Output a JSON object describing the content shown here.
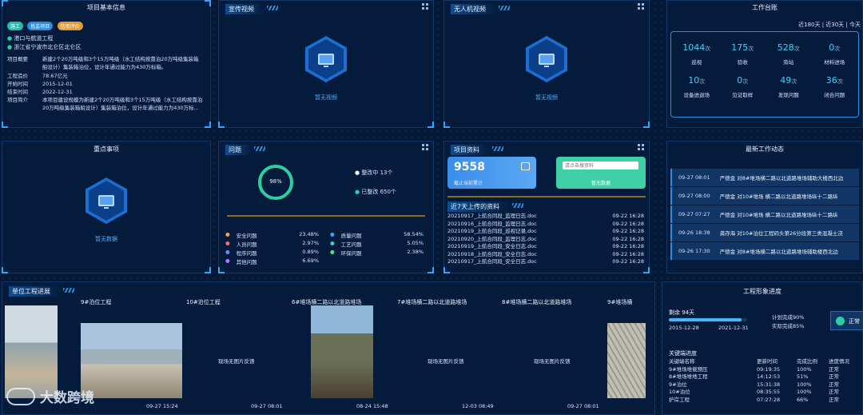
{
  "project_info": {
    "title": "项目基本信息",
    "tags": [
      "施工",
      "抵监项目",
      "信用评价"
    ],
    "bullets": [
      "港口与航道工程",
      "浙江省宁波市北仑区北仑区"
    ],
    "fields": [
      {
        "label": "项目概要",
        "value": "新建2个20万吨级和3个15万吨级（水工结构按靠泊20万吨级集装箱船设计）集装箱泊位，设计年通过能力为430万标箱。"
      },
      {
        "label": "工程造价",
        "value": "78.67亿元"
      },
      {
        "label": "开始时间",
        "value": "2015-12-01"
      },
      {
        "label": "结束时间",
        "value": "2022-12-31"
      },
      {
        "label": "项目简介",
        "value": "本项目建设规模为新建2个20万吨级和3个15万吨级（水工结构按靠泊20万吨级集装箱船设计）集装箱泊位，设计年通过能力为430万标..."
      }
    ]
  },
  "promo_video": {
    "title": "宣传视频",
    "empty": "暂无视频",
    "icon": "monitor-icon"
  },
  "drone_video": {
    "title": "无人机视频",
    "empty": "暂无视频",
    "icon": "monitor-icon"
  },
  "work_ledger": {
    "title": "工作台账",
    "filters": "近180天 | 近30天 | 今天",
    "stats": [
      {
        "n": "1044",
        "u": "次",
        "label": "巡视"
      },
      {
        "n": "175",
        "u": "次",
        "label": "验收"
      },
      {
        "n": "528",
        "u": "次",
        "label": "旁站"
      },
      {
        "n": "0",
        "u": "次",
        "label": "材料进场"
      },
      {
        "n": "10",
        "u": "次",
        "label": "设备进退场"
      },
      {
        "n": "0",
        "u": "次",
        "label": "见证取样"
      },
      {
        "n": "49",
        "u": "次",
        "label": "发现问题"
      },
      {
        "n": "36",
        "u": "次",
        "label": "闭合问题"
      }
    ]
  },
  "key_items": {
    "title": "重点事项",
    "empty": "暂无数据",
    "icon": "monitor-icon"
  },
  "issues": {
    "title": "问题",
    "percent": "98%",
    "percent_value": 0.98,
    "rectifying": "整改中 13个",
    "rectified": "已整改 650个",
    "categories": [
      {
        "name": "安全问题",
        "pct": "23.48%",
        "color": "#f0a04a"
      },
      {
        "name": "质量问题",
        "pct": "58.54%",
        "color": "#3fa0ff"
      },
      {
        "name": "人员问题",
        "pct": "2.97%",
        "color": "#ff6a6a"
      },
      {
        "name": "工艺问题",
        "pct": "5.05%",
        "color": "#3fd0c0"
      },
      {
        "name": "程序问题",
        "pct": "0.89%",
        "color": "#6a8cff"
      },
      {
        "name": "环保问题",
        "pct": "2.38%",
        "color": "#4fe08a"
      },
      {
        "name": "其他问题",
        "pct": "6.69%",
        "color": "#b07cff"
      }
    ]
  },
  "project_docs": {
    "title": "项目资料",
    "count": "9558",
    "count_label": "截止当前累计",
    "search_placeholder": "请点击搜资料",
    "no_data": "暂无数据",
    "recent_title": "近7天上传的资料",
    "files": [
      {
        "name": "20210917_上航合同段_监理日志.doc",
        "time": "09-22 16:28"
      },
      {
        "name": "20210916_上航合同段_监理日志.doc",
        "time": "09-22 16:28"
      },
      {
        "name": "20210919_上航合同段_巡视记录.doc",
        "time": "09-22 16:28"
      },
      {
        "name": "20210920_上航合同段_监理日志.doc",
        "time": "09-22 16:28"
      },
      {
        "name": "20210919_上航合同段_安全日志.doc",
        "time": "09-22 16:28"
      },
      {
        "name": "20210918_上航合同段_安全日志.doc",
        "time": "09-22 16:28"
      },
      {
        "name": "20210917_上航合同段_安全日志.doc",
        "time": "09-22 16:28"
      }
    ]
  },
  "recent_work": {
    "title": "最新工作动态",
    "items": [
      {
        "time": "09-27 08:01",
        "text": "严德金 对8#堆场横二路以北道路堆场辅助大楼西北边"
      },
      {
        "time": "09-27 08:00",
        "text": "严德金 对10#堆场 横二路以北道路堆场纵十二路纵"
      },
      {
        "time": "09-27 07:27",
        "text": "严德金 对10#堆场 横二路以北道路堆场纵十二路纵"
      },
      {
        "time": "09-26 18:38",
        "text": "龚存海 对10#泊位工程码头第26分段第三类混凝土浇"
      },
      {
        "time": "09-26 17:30",
        "text": "严德金 对8#堆场横二路以北道路堆场辅助楼西北边"
      }
    ]
  },
  "unit_progress": {
    "title": "单位工程进展",
    "units": [
      {
        "name": "9#泊位工程",
        "date": "09-27 15:24"
      },
      {
        "name": "10#泊位工程",
        "date": "09-27 08:01"
      },
      {
        "name": "6#堆场横二路以北道路堆场",
        "date": "08-24 15:48"
      },
      {
        "name": "7#堆场横二路以北道路堆场",
        "date": "12-03 08:49"
      },
      {
        "name": "8#堆场横二路以北道路堆场",
        "date": "09-27 08:01"
      },
      {
        "name": "9#堆场横",
        "date": ""
      }
    ],
    "no_pic": "现场无图片反馈"
  },
  "image_progress": {
    "title": "工程形象进度",
    "remaining": "剩余 94天",
    "progress_value": 0.93,
    "start": "2015-12-28",
    "end": "2021-12-31",
    "planned": "计划完成90%",
    "actual": "实际完成85%",
    "status": "正常",
    "key_title": "关键端进度",
    "headers": [
      "关键端名称",
      "更新时间",
      "完成比例",
      "进度情况"
    ],
    "rows": [
      [
        "9#堆场堆载预压",
        "09:19:35",
        "100%",
        "正常"
      ],
      [
        "8#堆场堆地工程",
        "14:12:53",
        "51%",
        "正常"
      ],
      [
        "9#泊位",
        "15:31:38",
        "100%",
        "正常"
      ],
      [
        "10#泊位",
        "08:35:55",
        "100%",
        "正常"
      ],
      [
        "护岸工程",
        "07:27:28",
        "66%",
        "正常"
      ]
    ]
  },
  "watermark": "大数跨境"
}
